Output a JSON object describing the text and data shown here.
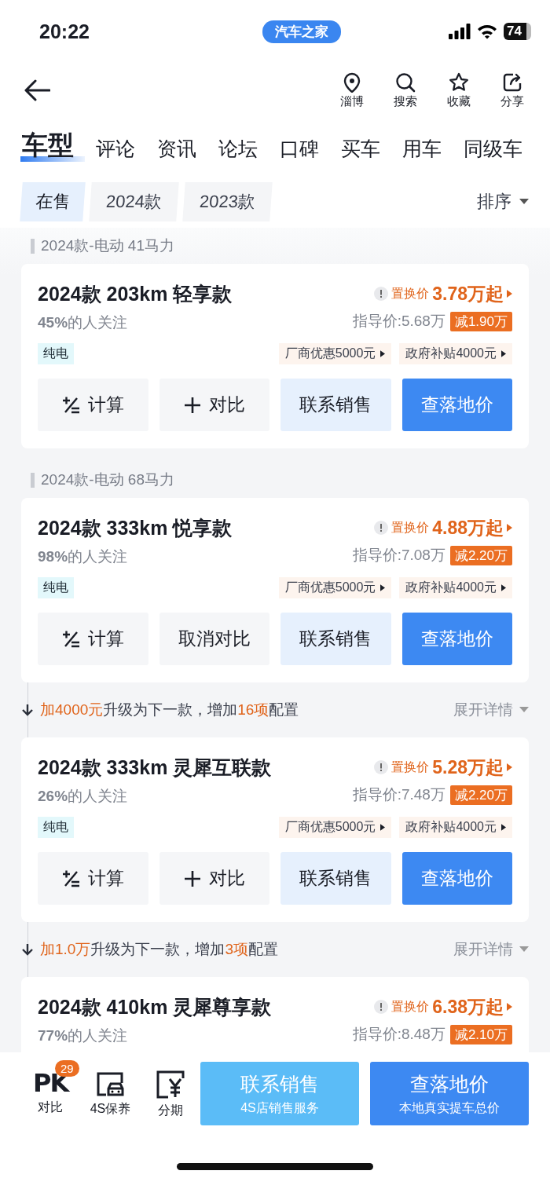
{
  "status_bar": {
    "time": "20:22",
    "app_pill": "汽车之家",
    "battery": "74"
  },
  "header": {
    "actions": [
      {
        "label": "淄博"
      },
      {
        "label": "搜索"
      },
      {
        "label": "收藏"
      },
      {
        "label": "分享"
      }
    ]
  },
  "tabs": [
    {
      "label": "车型",
      "selected": true
    },
    {
      "label": "评论",
      "selected": false
    },
    {
      "label": "资讯",
      "selected": false
    },
    {
      "label": "论坛",
      "selected": false
    },
    {
      "label": "口碑",
      "selected": false
    },
    {
      "label": "买车",
      "selected": false
    },
    {
      "label": "用车",
      "selected": false
    },
    {
      "label": "同级车",
      "selected": false
    }
  ],
  "filters": [
    {
      "label": "在售",
      "selected": true
    },
    {
      "label": "2024款",
      "selected": false
    },
    {
      "label": "2023款",
      "selected": false
    }
  ],
  "sort": "排序",
  "list": [
    {
      "kind": "group_heading",
      "text": "2024款-电动 41马力"
    },
    {
      "kind": "model",
      "title": "2024款 203km 轻享款",
      "attention_pct": "45%",
      "attention_text": "的人关注",
      "trade_in_label": "置换价",
      "trade_in_price": "3.78万起",
      "guide_price": "指导价:5.68万",
      "discount": "减1.90万",
      "tag": "纯电",
      "promos": [
        "厂商优惠5000元",
        "政府补贴4000元"
      ],
      "buttons": [
        {
          "kind": "calc",
          "label": "计算"
        },
        {
          "kind": "compare",
          "label": "对比",
          "added": false
        },
        {
          "kind": "contact",
          "label": "联系销售"
        },
        {
          "kind": "price",
          "label": "查落地价"
        }
      ]
    },
    {
      "kind": "group_heading",
      "text": "2024款-电动 68马力"
    },
    {
      "kind": "model",
      "title": "2024款 333km 悦享款",
      "attention_pct": "98%",
      "attention_text": "的人关注",
      "trade_in_label": "置换价",
      "trade_in_price": "4.88万起",
      "guide_price": "指导价:7.08万",
      "discount": "减2.20万",
      "tag": "纯电",
      "promos": [
        "厂商优惠5000元",
        "政府补贴4000元"
      ],
      "buttons": [
        {
          "kind": "calc",
          "label": "计算"
        },
        {
          "kind": "compare",
          "label": "取消对比",
          "added": true
        },
        {
          "kind": "contact",
          "label": "联系销售"
        },
        {
          "kind": "price",
          "label": "查落地价"
        }
      ]
    },
    {
      "kind": "upgrade",
      "parts": [
        {
          "text": "加4000元",
          "highlight": true
        },
        {
          "text": "升级为下一款，增加",
          "highlight": false
        },
        {
          "text": "16项",
          "highlight": true
        },
        {
          "text": "配置",
          "highlight": false
        }
      ],
      "action": "展开详情"
    },
    {
      "kind": "model",
      "title": "2024款 333km 灵犀互联款",
      "attention_pct": "26%",
      "attention_text": "的人关注",
      "trade_in_label": "置换价",
      "trade_in_price": "5.28万起",
      "guide_price": "指导价:7.48万",
      "discount": "减2.20万",
      "tag": "纯电",
      "promos": [
        "厂商优惠5000元",
        "政府补贴4000元"
      ],
      "buttons": [
        {
          "kind": "calc",
          "label": "计算"
        },
        {
          "kind": "compare",
          "label": "对比",
          "added": false
        },
        {
          "kind": "contact",
          "label": "联系销售"
        },
        {
          "kind": "price",
          "label": "查落地价"
        }
      ]
    },
    {
      "kind": "upgrade",
      "parts": [
        {
          "text": "加1.0万",
          "highlight": true
        },
        {
          "text": "升级为下一款，增加",
          "highlight": false
        },
        {
          "text": "3项",
          "highlight": true
        },
        {
          "text": "配置",
          "highlight": false
        }
      ],
      "action": "展开详情"
    },
    {
      "kind": "model",
      "title": "2024款 410km 灵犀尊享款",
      "attention_pct": "77%",
      "attention_text": "的人关注",
      "trade_in_label": "置换价",
      "trade_in_price": "6.38万起",
      "guide_price": "指导价:8.48万",
      "discount": "减2.10万"
    }
  ],
  "bottom_bar": {
    "tools": [
      {
        "mark": "PK",
        "label": "对比",
        "badge": "29"
      },
      {
        "label": "4S保养"
      },
      {
        "label": "分期"
      }
    ],
    "actions": [
      {
        "kind": "contact",
        "title": "联系销售",
        "subtitle": "4S店销售服务"
      },
      {
        "kind": "price",
        "title": "查落地价",
        "subtitle": "本地真实提车总价"
      }
    ]
  }
}
